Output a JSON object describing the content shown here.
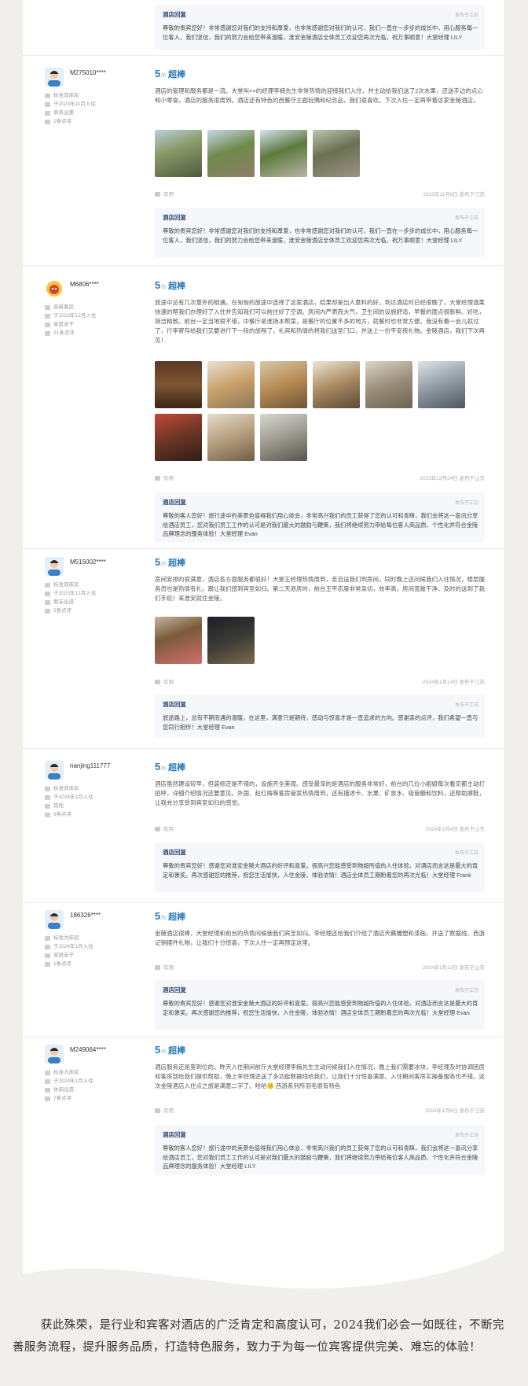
{
  "reviews": [
    {
      "reply": {
        "title": "酒店回复",
        "date": "发布于江苏",
        "text": "尊敬的贵宾您好！非常感谢您对我们的支持和厚爱，也非常感谢您对我们的认可，我们一直在一步步的成长中，用心服务每一位客人，我们坚信，我们的努力会给您带来温暖，淮安金陵酒店全体员工欢迎您再次光临，祝万事顺意！大堂经理 LILY"
      }
    },
    {
      "user": {
        "name": "M275010****",
        "room": "标准双床房",
        "stay": "于2023年11月入住",
        "type": "商务出差",
        "count": "2条点评"
      },
      "score": "5",
      "score_suffix": "/5",
      "rating_word": "超棒",
      "text": "酒店的管理和服务都是一流。大堂叫××的经理李楠先生非常热情的迎接我们入住，并主动给我们送了2次水果，还送手边的点心和小零食，酒店的服务很周到。酒店还有特色的西餐厅主题玩偶和纪念品，我们很喜欢。下次入住一定再带着这家金陵酒店。",
      "photo_count": 4,
      "useful": "有用",
      "date": "2023年11月8日 发布于江苏",
      "reply": {
        "title": "酒店回复",
        "date": "发布于江苏",
        "text": "尊敬的贵宾您好！非常感谢您对我们的支持和厚爱，也非常感谢您对我们的认可，我们一直在一步步的成长中，用心服务每一位客人，我们坚信，我们的努力会给您带来温暖，淮安金陵酒店全体员工欢迎您再次光临，祝万事顺意！大堂经理 LILY"
      }
    },
    {
      "user": {
        "name": "M6806****",
        "room": "高级客房",
        "stay": "于2023年12月入住",
        "type": "家庭亲子",
        "count": "21条点评"
      },
      "score": "5",
      "score_suffix": "/5",
      "rating_word": "超棒",
      "text": "旅途中总有几次意外的相遇。在匆匆的旅途中选择了这家酒店，结果却是出人意料的好。到达酒店时已经很晚了，大堂经理温柔快速的帮我们办理好了入住并告知我们可以前往好了空调。房间内严肃而大气，卫生间的设施舒适，早餐的面点很新鲜。好吃，简洁精致。前台一定当地很不错，中餐厅是淮扬本帮菜，是餐厅的位置不多的地方，就餐时也非常方便。我没有看一会儿就过了，行李寄存给我们又要进行下一段的旅程了，礼宾和热情的将我们送至门口，并送上一份平安夜礼物。金陵酒店，我们下次再见！",
      "photo_count": 9,
      "useful": "有用",
      "date": "2023年12月24日 发布于山东",
      "reply": {
        "title": "酒店回复",
        "date": "发布于江苏",
        "text": "尊敬的客人您好！旅行途中的美景色值得我们用心体会，非常高兴我们的员工获得了您的认可和青睐，我们会将这一喜讯分享给酒店员工，您对我们员工工作的认可是对我们最大的鼓励与鞭策，我们将继续努力带给每位客人高品质、个性化并符合金陵品牌理念的服务体验！大堂经理 Evan"
      }
    },
    {
      "user": {
        "name": "M515002****",
        "room": "标准双床房",
        "stay": "于2023年12月入住",
        "type": "朋友出游",
        "count": "5条点评"
      },
      "score": "5",
      "score_suffix": "/5",
      "rating_word": "超棒",
      "text": "房间安排的很满意，酒店各方面服务都很好！大堂王经理热情周到，亲自送我们到房间，同时晚上还问候我们入住情况，楼层服务员也是热情有礼，跟让我们感到宾至如归。第二天退房时，前台王平态度非常亲切，效率高，房间宽敞干净，及时的送到了我们手机！来淮安就住金陵。",
      "photo_count": 2,
      "useful": "有用",
      "date": "2024年1月14日 发布于江苏",
      "reply": {
        "title": "酒店回复",
        "date": "发布于江苏",
        "text": "旅途路上，总有不期而遇的温暖，在这里，满意只是期待，感动与惊喜才是一直追求的方向。感谢亲的点评，我们希望一直与您同行相伴！大堂经理 Evan"
      }
    },
    {
      "user": {
        "name": "nanjing111777",
        "room": "标准双床房",
        "stay": "于2024年1月入住",
        "type": "其他",
        "count": "6条点评"
      },
      "score": "5",
      "score_suffix": "/5",
      "rating_word": "超棒",
      "text": "酒店虽然建设较早，但装修还是不错的，设施齐全美观。感受最深的是酒店的服务非常好，前台的几位小姐姐每次看见都主动打招呼，详细介绍情况还要意见。外国、赵红梅等客房管家热情周到，还有描述卡、水果、矿泉水、吸管糖和饮料，还帮助擦鞋，让我充分享受到宾至如归的感觉。",
      "useful": "有用",
      "date": "2024年1月4日 发布于山东",
      "reply": {
        "title": "酒店回复",
        "date": "发布于江苏",
        "text": "尊敬的贵宾您好！感谢您对淮安金陵大酒店的好评和喜爱。很高兴您能感受到物超所值的入住体验，对酒店而言这是最大的肯定和褒奖。再次感谢您的推荐，祝您生活愉快，入住金陵，体验浓情！酒店全体员工期盼着您的再次光临！大堂经理 Frank"
      }
    },
    {
      "user": {
        "name": "186326****",
        "room": "标准大床房",
        "stay": "于2024年1月入住",
        "type": "家庭亲子",
        "count": "1条点评"
      },
      "score": "5",
      "score_suffix": "/5",
      "rating_word": "超棒",
      "text": "金陵酒店很棒，大堂经理和前台的热情问候使我们宾至如归。李经理还给我们介绍了酒店天籁雕塑和漆画，并送了数据线、西游记铜摆件礼物，让我们十分惊喜，下次入住一定再预定这里。",
      "useful": "有用",
      "date": "2024年1月13日 发布于山东",
      "reply": {
        "title": "酒店回复",
        "date": "发布于江苏",
        "text": "尊敬的贵宾您好！感谢您对淮安金陵大酒店的好评和喜爱。很高兴您能感受到物超所值的入住体验，对酒店而言这是最大的肯定和褒奖。再次感谢您的推荐，祝您生活愉快，入住金陵，体验浓情！酒店全体员工期盼着您的再次光临！大堂经理 Evan"
      }
    },
    {
      "user": {
        "name": "M249064****",
        "room": "标准大床房",
        "stay": "于2024年1月入住",
        "type": "休闲出游",
        "count": "7条点评"
      },
      "score": "5",
      "score_suffix": "/5",
      "rating_word": "超棒",
      "text": "酒店服务还是蛮到位的。昨天入住期间前厅大堂经理李楠先生主动问候我们入住情况，晚上我们需要冰块，李经理及时协调团房和客房部给我们提供帮助，晚上李经理还送了多功能数据线给我们，让我们十分惊喜满意。入住期间客房实操备服务也不错。这次金陵酒店入住点之旅是满意二字了。哈哈🙂 西游系列所羽毛很有特色",
      "useful": "有用",
      "date": "2024年1月6日 发布于江苏",
      "reply": {
        "title": "酒店回复",
        "date": "发布于江苏",
        "text": "尊敬的客人您好！旅行途中的美景色值得我们用心体会，非常高兴我们的员工获得了您的认可和青睐，我们会将这一喜讯分享给酒店员工，您对我们员工工作的认可是对我们最大的鼓励与鞭策，我们将继续努力带给每位客人高品质、个性化并符合金陵品牌理念的服务体验！大堂经理 LILY"
      }
    }
  ],
  "footer": {
    "text": "获此殊荣，是行业和宾客对酒店的广泛肯定和高度认可，2024我们必会一如既往，不断完善服务流程，提升服务品质，打造特色服务，致力于为每一位宾客提供完美、难忘的体验！"
  },
  "colors": {
    "accent": "#2a7ab8",
    "reply_title": "#2b4673",
    "reply_bg": "#f6f7fa",
    "page_bg": "#f1efec",
    "corner_icon": "#e0493c"
  },
  "icons": [
    "avatar",
    "room-icon",
    "calendar-icon",
    "trip-icon",
    "reviews-icon",
    "thumbs-up-icon",
    "link-icon"
  ]
}
